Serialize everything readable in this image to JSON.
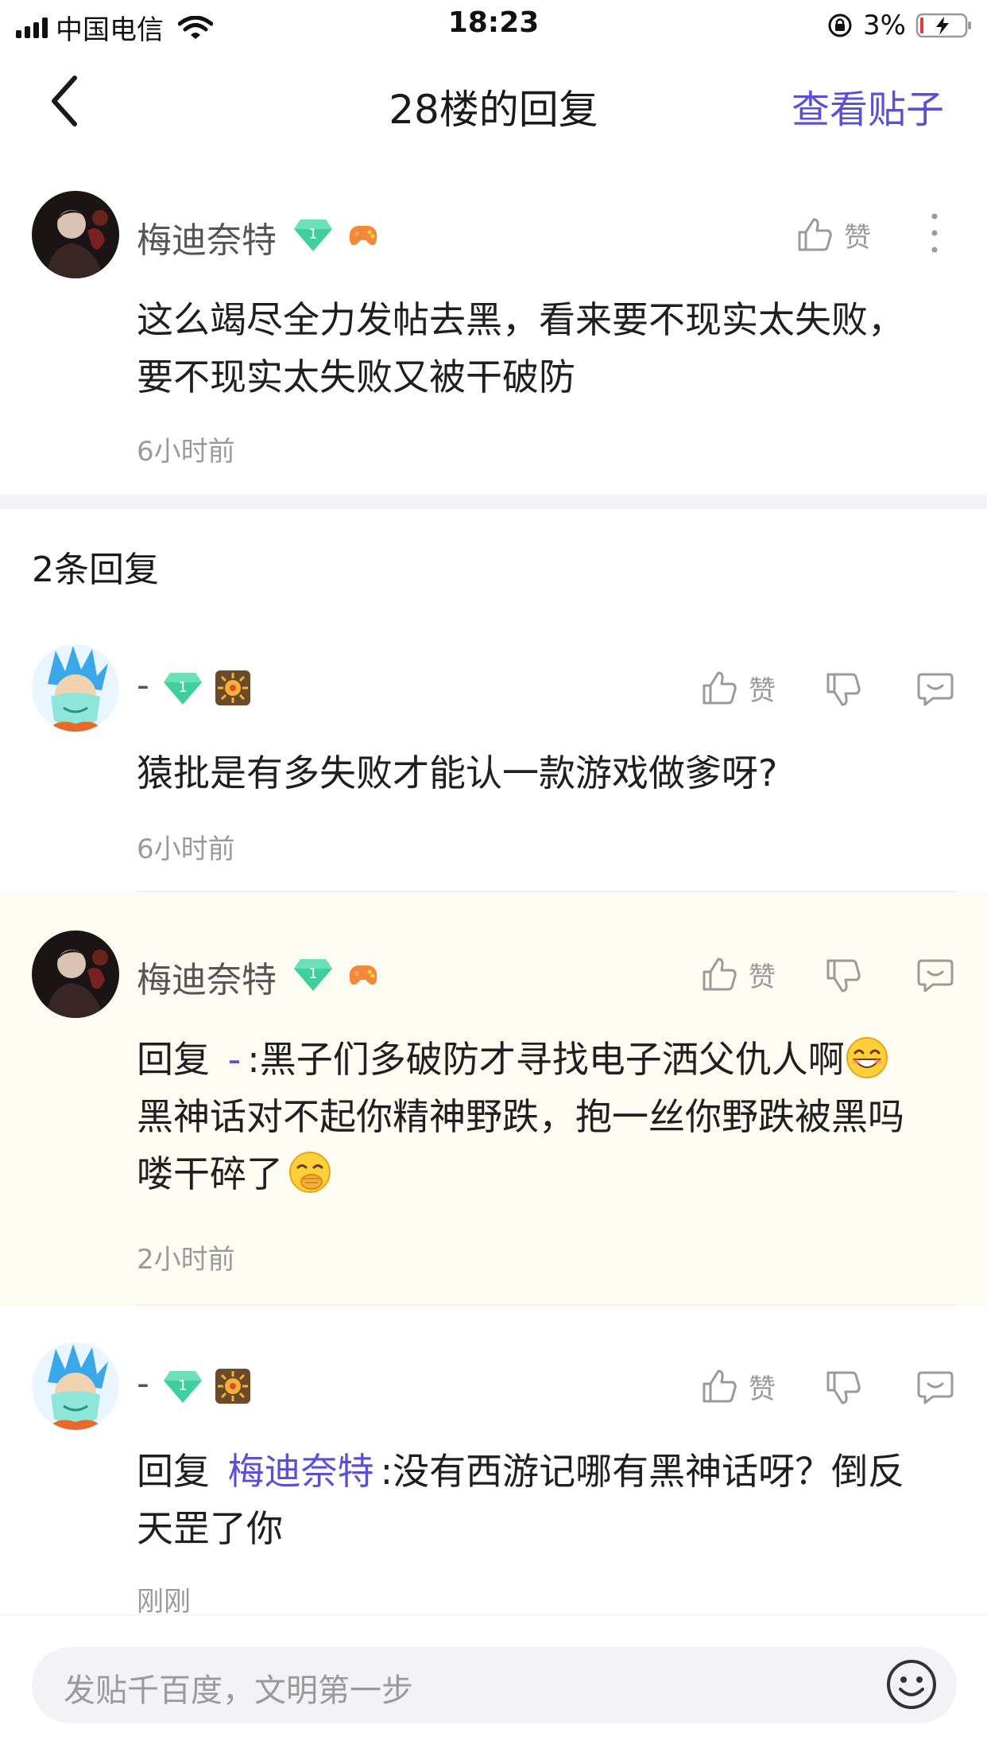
{
  "status_bar": {
    "carrier": "中国电信",
    "time": "18:23",
    "battery_percent": "3%"
  },
  "nav": {
    "title": "28楼的回复",
    "view_post": "查看贴子"
  },
  "main_comment": {
    "username": "梅迪奈特",
    "level": "1",
    "like_label": "赞",
    "text_line1": "这么竭尽全力发帖去黑，看来要不现实太失败，",
    "text_line2": "要不现实太失败又被干破防",
    "time": "6小时前"
  },
  "replies_count": "2条回复",
  "replies": [
    {
      "username": "-",
      "level": "1",
      "like_label": "赞",
      "text": "猿批是有多失败才能认一款游戏做爹呀?",
      "time": "6小时前"
    },
    {
      "username": "梅迪奈特",
      "level": "1",
      "like_label": "赞",
      "reply_prefix": "回复",
      "mention": "-",
      "text_line1": ":黑子们多破防才寻找电子洒父仇人啊",
      "text_line2": "黑神话对不起你精神野跌，抱一丝你野跌被黑吗",
      "text_line3": "喽干碎了",
      "time": "2小时前"
    },
    {
      "username": "-",
      "level": "1",
      "like_label": "赞",
      "reply_prefix": "回复",
      "mention": "梅迪奈特",
      "text_line1": ":没有西游记哪有黑神话呀？倒反",
      "text_line2": "天罡了你",
      "time": "刚刚"
    }
  ],
  "input": {
    "placeholder": "发贴千百度，文明第一步"
  },
  "colors": {
    "accent": "#5b4fd6",
    "gem": "#3fcf9e",
    "highlight_bg": "#fdfcf2"
  },
  "icons": [
    "back-icon",
    "thumb-up-icon",
    "thumb-down-icon",
    "comment-icon",
    "more-icon",
    "smile-icon",
    "level-gem-icon"
  ]
}
